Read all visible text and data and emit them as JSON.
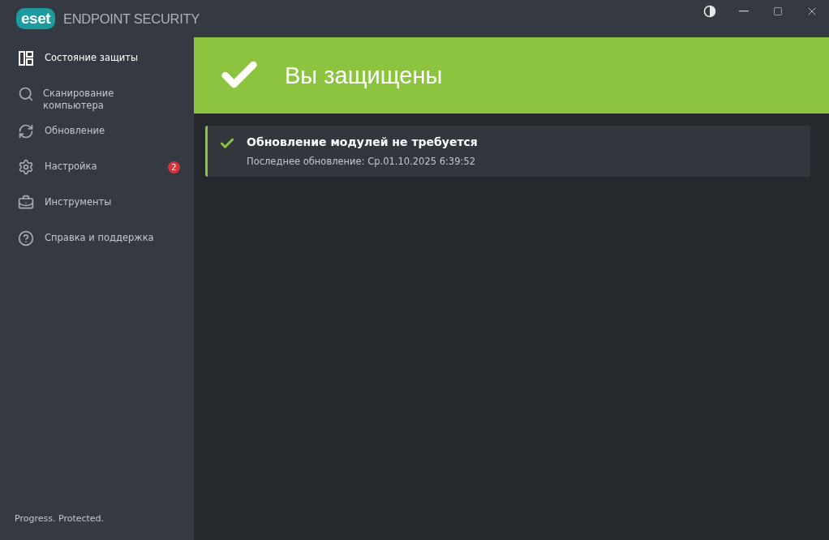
{
  "header": {
    "logo": "eset",
    "product": "ENDPOINT SECURITY"
  },
  "sidebar": {
    "items": [
      {
        "label": "Состояние защиты",
        "selected": true
      },
      {
        "label": "Сканирование компьютера",
        "selected": false
      },
      {
        "label": "Обновление",
        "selected": false
      },
      {
        "label": "Настройка",
        "selected": false,
        "badge": "2"
      },
      {
        "label": "Инструменты",
        "selected": false
      },
      {
        "label": "Справка и поддержка",
        "selected": false
      }
    ],
    "footer": "Progress. Protected."
  },
  "banner": {
    "title": "Вы защищены"
  },
  "cards": [
    {
      "title": "Обновление модулей не требуется",
      "detail": "Последнее обновление: Ср.01.10.2025 6:39:52"
    }
  ]
}
